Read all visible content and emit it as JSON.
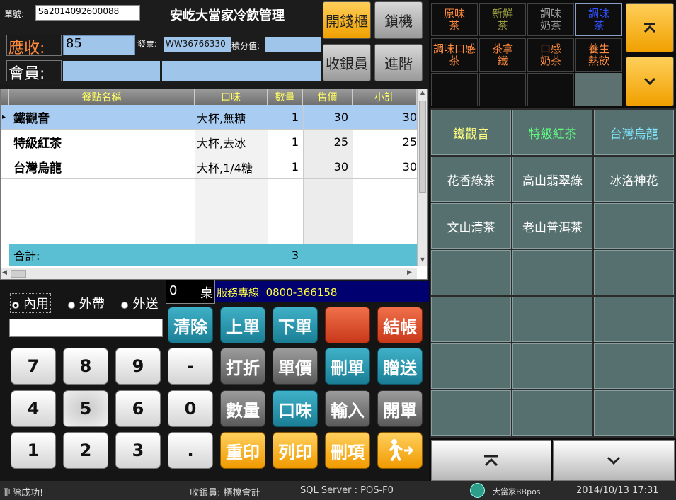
{
  "header": {
    "order_no_label": "單號:",
    "order_no": "Sa2014092600088",
    "title": "安屹大當家冷飲管理",
    "receivable_label": "應收:",
    "receivable": "85",
    "invoice_label": "發票:",
    "invoice_no": "WW36766330",
    "points_label": "積分值:",
    "points": "",
    "member_label": "會員:",
    "member_id": "",
    "member_name": ""
  },
  "top_buttons": {
    "cash_drawer": "開錢櫃",
    "lock": "鎖機",
    "cashier": "收銀員",
    "advanced": "進階"
  },
  "order_table": {
    "columns": [
      "餐點名稱",
      "口味",
      "數量",
      "售價",
      "小計"
    ],
    "rows": [
      [
        "鐵觀音",
        "大杯,無糖",
        "1",
        "30",
        "30"
      ],
      [
        "特級紅茶",
        "大杯,去冰",
        "1",
        "25",
        "25"
      ],
      [
        "台灣烏龍",
        "大杯,1/4糖",
        "1",
        "30",
        "30"
      ]
    ],
    "total_label": "合計:",
    "total_qty": "3"
  },
  "order_type": {
    "options": [
      "內用",
      "外帶",
      "外送"
    ],
    "selected": "內用",
    "table_no": "0",
    "table_unit": "桌"
  },
  "service_line": {
    "label": "服務專線",
    "phone": "0800-366158"
  },
  "numpad": {
    "keys": [
      "7",
      "8",
      "9",
      "-",
      "4",
      "5",
      "6",
      "0",
      "1",
      "2",
      "3",
      "."
    ]
  },
  "function_buttons": {
    "clear": "清除",
    "prev_order": "上單",
    "next_order": "下單",
    "blank": "",
    "checkout": "結帳",
    "discount": "打折",
    "unit_price": "單價",
    "delete_order": "刪單",
    "gift": "贈送",
    "quantity": "數量",
    "flavor": "口味",
    "input": "輸入",
    "open_order": "開單",
    "reprint": "重印",
    "print": "列印",
    "delete_item": "刪項"
  },
  "categories": [
    {
      "label": "原味茶",
      "color": "#ff8a3d"
    },
    {
      "label": "新鮮茶",
      "color": "#a0a040"
    },
    {
      "label": "調味奶茶",
      "color": "#a0a0a0"
    },
    {
      "label": "調味茶",
      "color": "#3050ff"
    },
    {
      "label": "調味口感茶",
      "color": "#ff8a3d"
    },
    {
      "label": "茶拿鐵",
      "color": "#ff8a3d"
    },
    {
      "label": "口感奶茶",
      "color": "#ff8a3d"
    },
    {
      "label": "養生熱飲",
      "color": "#ff8a3d"
    }
  ],
  "products": [
    {
      "label": "鐵觀音",
      "color": "#ffff80"
    },
    {
      "label": "特級紅茶",
      "color": "#60ff80"
    },
    {
      "label": "台灣烏龍",
      "color": "#80e8ff"
    },
    {
      "label": "花香綠茶",
      "color": "#ffffff"
    },
    {
      "label": "高山翡翠綠",
      "color": "#ffffff"
    },
    {
      "label": "冰洛神花",
      "color": "#ffffff"
    },
    {
      "label": "文山清茶",
      "color": "#ffffff"
    },
    {
      "label": "老山普洱茶",
      "color": "#ffffff"
    }
  ],
  "status_bar": {
    "message": "刪除成功!",
    "cashier": "收銀員: 櫃檯會計",
    "server": "SQL Server : POS-F0",
    "brand": "大當家BBpos",
    "datetime": "2014/10/13 17:31"
  }
}
